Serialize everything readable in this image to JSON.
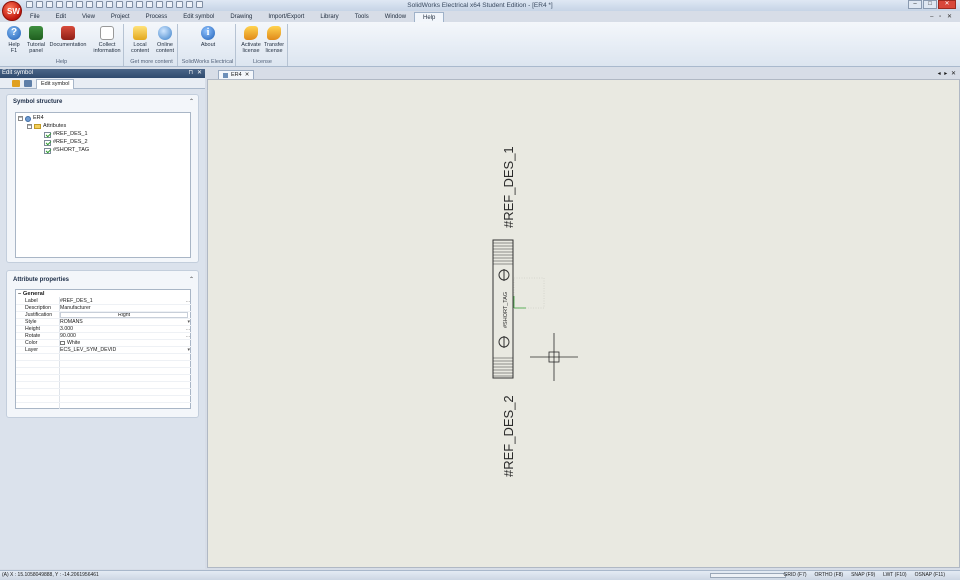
{
  "window": {
    "title": "SolidWorks Electrical x64 Student Edition - [ER4 *]",
    "app_logo_text": "SW",
    "controls": {
      "minimize": "–",
      "maximize": "□",
      "close": "✕"
    },
    "mdi_controls": "– ▫ ✕"
  },
  "menu": [
    "File",
    "Edit",
    "View",
    "Project",
    "Process",
    "Edit symbol",
    "Drawing",
    "Import/Export",
    "Library",
    "Tools",
    "Window",
    "Help"
  ],
  "menu_active": "Help",
  "ribbon": {
    "groups": [
      {
        "label": "Help",
        "buttons": [
          {
            "label1": "Help",
            "label2": "F1",
            "icon": "help-icon"
          },
          {
            "label1": "Tutorial",
            "label2": "panel",
            "icon": "tutorial-icon"
          },
          {
            "label1": "Documentation",
            "label2": "",
            "icon": "documentation-icon"
          },
          {
            "label1": "Collect",
            "label2": "information",
            "icon": "collect-information-icon"
          }
        ]
      },
      {
        "label": "Get more content",
        "buttons": [
          {
            "label1": "Local",
            "label2": "content",
            "icon": "local-content-icon"
          },
          {
            "label1": "Online",
            "label2": "content",
            "icon": "online-content-icon"
          }
        ]
      },
      {
        "label": "SolidWorks Electrical",
        "buttons": [
          {
            "label1": "About",
            "label2": "",
            "icon": "about-icon"
          }
        ]
      },
      {
        "label": "License",
        "buttons": [
          {
            "label1": "Activate",
            "label2": "license",
            "icon": "activate-license-icon"
          },
          {
            "label1": "Transfer",
            "label2": "license",
            "icon": "transfer-license-icon"
          }
        ]
      }
    ]
  },
  "left_panel": {
    "title": "Edit symbol",
    "pin": "⊓",
    "close": "✕",
    "tab": "Edit symbol",
    "structure": {
      "title": "Symbol structure",
      "collapse": "⌃",
      "tree": {
        "root": "ER4",
        "folder": "Attributes",
        "items": [
          "#REF_DES_1",
          "#REF_DES_2",
          "#SHORT_TAG"
        ],
        "expand_glyph": "–"
      }
    },
    "attributes": {
      "title": "Attribute properties",
      "collapse": "⌃",
      "group": "General",
      "rows": [
        {
          "key": "Label",
          "value": "#REF_DES_1",
          "dd": "..."
        },
        {
          "key": "Description",
          "value": "Manufacturer",
          "dd": ""
        },
        {
          "key": "Justification",
          "value": "Right",
          "dd": ""
        },
        {
          "key": "Style",
          "value": "ROMANS",
          "dd": "▾"
        },
        {
          "key": "Height",
          "value": "3.000",
          "dd": "..."
        },
        {
          "key": "Rotate",
          "value": "90.000",
          "dd": "..."
        },
        {
          "key": "Color",
          "value": "White",
          "dd": ""
        },
        {
          "key": "Layer",
          "value": "ECS_LEV_SYM_DEVID",
          "dd": "▾"
        }
      ]
    }
  },
  "document": {
    "tab": "ER4",
    "tab_close": "✕",
    "tab_nav": "◂ ▸ ✕",
    "labels": {
      "top": "#REF_DES_1",
      "bottom": "#REF_DES_2",
      "center": "#SHORT_TAG"
    }
  },
  "status": {
    "coords": "(A) X : 15.1058049888, Y : -14.2061956461",
    "progress": 0,
    "toggles": [
      "GRID (F7)",
      "ORTHO (F8)",
      "SNAP (F9)",
      "LWT (F10)",
      "OSNAP (F11)"
    ]
  }
}
